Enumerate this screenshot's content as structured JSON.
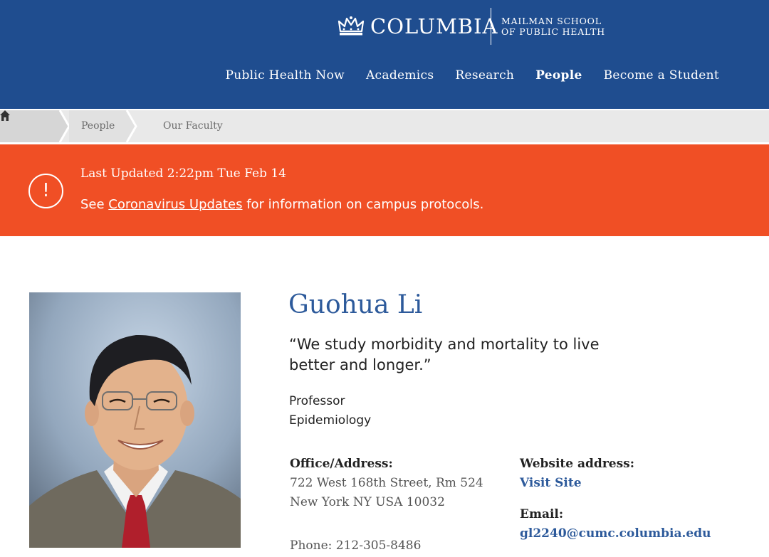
{
  "header": {
    "wordmark": "COLUMBIA",
    "school_line1": "MAILMAN SCHOOL",
    "school_line2": "OF PUBLIC HEALTH",
    "brand_color": "#1f4d8f",
    "nav": [
      {
        "label": "Public Health Now",
        "active": false
      },
      {
        "label": "Academics",
        "active": false
      },
      {
        "label": "Research",
        "active": false
      },
      {
        "label": "People",
        "active": true
      },
      {
        "label": "Become a Student",
        "active": false
      }
    ]
  },
  "breadcrumb": {
    "home_icon": "home-icon",
    "items": [
      "People",
      "Our Faculty"
    ]
  },
  "alert": {
    "color": "#f04f25",
    "icon": "exclamation-circle-icon",
    "title": "Last Updated 2:22pm Tue Feb 14",
    "text_before": "See ",
    "link": "Coronavirus Updates",
    "text_after": " for information on campus protocols."
  },
  "profile": {
    "name": "Guohua Li",
    "quote": "“We study morbidity and mortality to live better and longer.”",
    "title": "Professor",
    "department": "Epidemiology",
    "office_label": "Office/Address:",
    "address_line1": "722 West 168th Street, Rm 524",
    "address_line2": "New York NY USA 10032",
    "phone": "Phone: 212-305-8486",
    "website_label": "Website address:",
    "website_link": "Visit Site",
    "email_label": "Email:",
    "email": "gl2240@cumc.columbia.edu"
  }
}
